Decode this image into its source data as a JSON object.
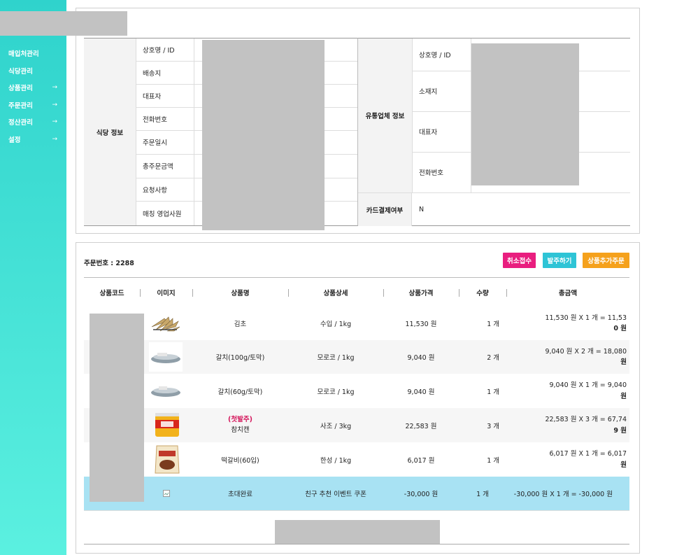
{
  "sidebar": {
    "items": [
      {
        "label": "매입처관리",
        "arrow": ""
      },
      {
        "label": "식당관리",
        "arrow": ""
      },
      {
        "label": "상품관리",
        "arrow": "→"
      },
      {
        "label": "주문관리",
        "arrow": "→"
      },
      {
        "label": "정산관리",
        "arrow": "→"
      },
      {
        "label": "설정",
        "arrow": "→"
      }
    ]
  },
  "restaurant": {
    "category": "식당 정보",
    "labels": [
      "상호명 / ID",
      "배송지",
      "대표자",
      "전화번호",
      "주문일시",
      "총주문금액",
      "요청사항",
      "매칭 영업사원"
    ]
  },
  "distributor": {
    "category": "유통업체 정보",
    "labels": [
      "상호명 / ID",
      "소재지",
      "대표자",
      "전화번호"
    ],
    "card_label": "카드결제여부",
    "card_value": "N"
  },
  "order": {
    "number_label": "주문번호 : 2288",
    "buttons": {
      "cancel": "취소접수",
      "dispatch": "발주하기",
      "add": "상품추가주문"
    },
    "colors": {
      "cancel": "#e91e7f",
      "dispatch": "#2ec4d6",
      "add": "#f5a11c",
      "highlight": "#a8e2f3"
    },
    "columns": [
      "상품코드",
      "이미지",
      "상품명",
      "상품상세",
      "상품가격",
      "수량",
      "총금액"
    ],
    "rows": [
      {
        "name": "김초",
        "badge": "",
        "detail": "수입 / 1kg",
        "price": "11,530 원",
        "qty": "1 개",
        "total1": "11,530 원 X 1 개 = 11,53",
        "total2": "0 원",
        "image": "seaweed-image"
      },
      {
        "name": "갈치(100g/토막)",
        "badge": "",
        "detail": "모로코 / 1kg",
        "price": "9,040 원",
        "qty": "2 개",
        "total1": "9,040 원 X 2 개 = 18,080",
        "total2": "원",
        "image": "fish-image"
      },
      {
        "name": "갈치(60g/토막)",
        "badge": "",
        "detail": "모로코 / 1kg",
        "price": "9,040 원",
        "qty": "1 개",
        "total1": "9,040 원 X 1 개 = 9,040",
        "total2": "원",
        "image": "fish-image"
      },
      {
        "name": "참치캔",
        "badge": "(첫발주)",
        "detail": "사조 / 3kg",
        "price": "22,583 원",
        "qty": "3 개",
        "total1": "22,583 원 X 3 개 = 67,74",
        "total2": "9 원",
        "image": "tuna-can-image"
      },
      {
        "name": "떡갈비(60입)",
        "badge": "",
        "detail": "한성 / 1kg",
        "price": "6,017 원",
        "qty": "1 개",
        "total1": "6,017 원 X 1 개 = 6,017",
        "total2": "원",
        "image": "galbi-pack-image"
      },
      {
        "name": "초대완료",
        "badge": "",
        "detail": "친구 추천 이벤트 쿠폰",
        "price": "-30,000 원",
        "qty": "1 개",
        "total1": "-30,000 원 X 1 개 = -30,000 원",
        "total2": "",
        "image": "broken-image-icon"
      }
    ]
  }
}
